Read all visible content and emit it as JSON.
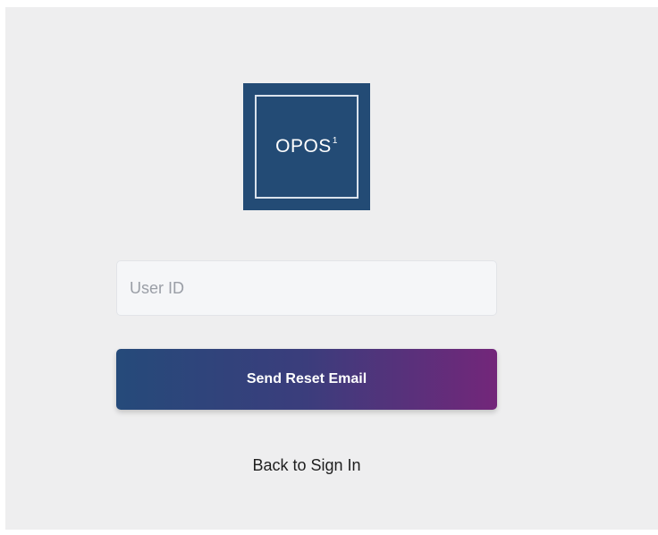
{
  "logo": {
    "text": "OPOS",
    "superscript": "1",
    "background_color": "#234b75"
  },
  "form": {
    "user_id_placeholder": "User ID",
    "user_id_value": "",
    "submit_label": "Send Reset Email",
    "button_gradient": [
      "#254a7a",
      "#73267a"
    ]
  },
  "footer": {
    "back_label": "Back to Sign In"
  }
}
